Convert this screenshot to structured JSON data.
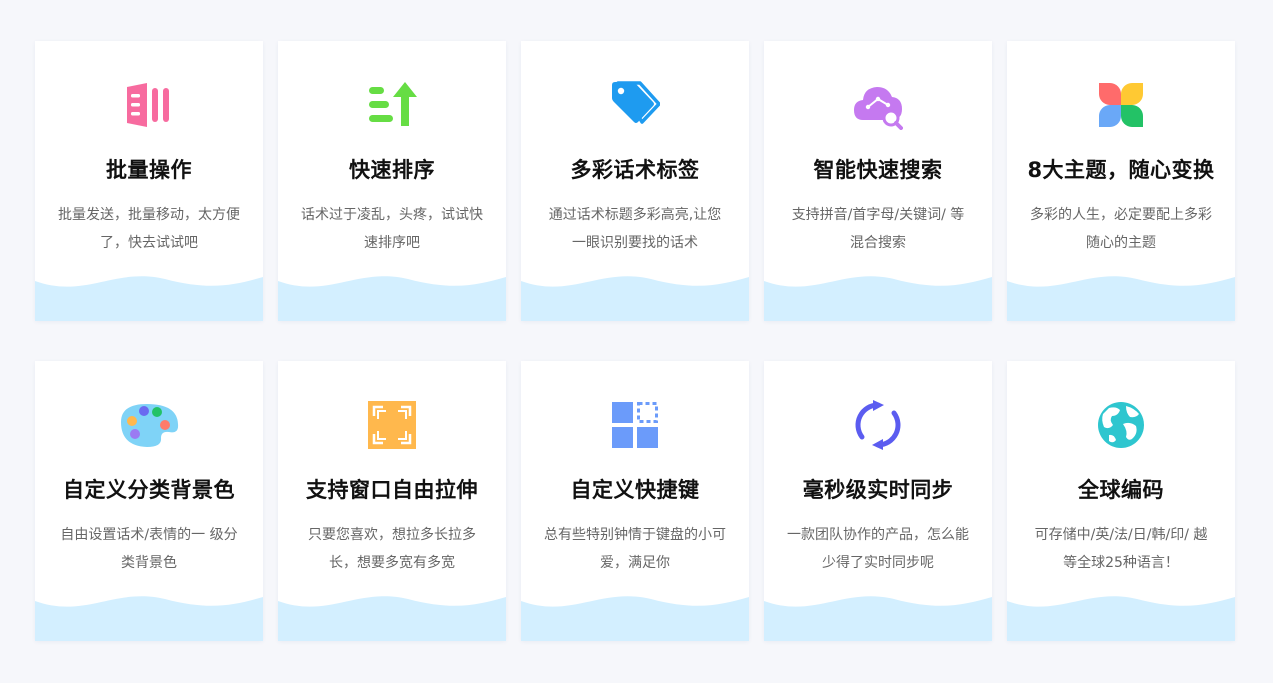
{
  "features": [
    {
      "title": "批量操作",
      "desc": "批量发送，批量移动，太方便了，快去试试吧",
      "icon": "batch-icon",
      "color": "#f76b9f"
    },
    {
      "title": "快速排序",
      "desc": "话术过于凌乱，头疼，试试快速排序吧",
      "icon": "sort-icon",
      "color": "#66dd44"
    },
    {
      "title": "多彩话术标签",
      "desc": "通过话术标题多彩高亮,让您一眼识别要找的话术",
      "icon": "tag-icon",
      "color": "#1e9bf0"
    },
    {
      "title": "智能快速搜索",
      "desc": "支持拼音/首字母/关键词/ 等混合搜索",
      "icon": "cloud-search-icon",
      "color": "#c579f0"
    },
    {
      "title": "8大主题，随心变换",
      "desc": "多彩的人生，必定要配上多彩随心的主题",
      "icon": "theme-icon",
      "color": "#ff6b6b"
    },
    {
      "title": "自定义分类背景色",
      "desc": "自由设置话术/表情的一 级分类背景色",
      "icon": "palette-icon",
      "color": "#7fd3f7"
    },
    {
      "title": "支持窗口自由拉伸",
      "desc": "只要您喜欢，想拉多长拉多长，想要多宽有多宽",
      "icon": "resize-icon",
      "color": "#ffb84d"
    },
    {
      "title": "自定义快捷键",
      "desc": "总有些特别钟情于键盘的小可爱，满足你",
      "icon": "shortcut-icon",
      "color": "#6b9bfa"
    },
    {
      "title": "毫秒级实时同步",
      "desc": "一款团队协作的产品，怎么能少得了实时同步呢",
      "icon": "sync-icon",
      "color": "#5b5cf0"
    },
    {
      "title": "全球编码",
      "desc": "可存储中/英/法/日/韩/印/ 越等全球25种语言！",
      "icon": "globe-icon",
      "color": "#2ec6cf"
    }
  ],
  "colors": {
    "wave": "#d3efff",
    "title": "#111111",
    "desc": "#666666",
    "background": "#f6f7fb"
  }
}
